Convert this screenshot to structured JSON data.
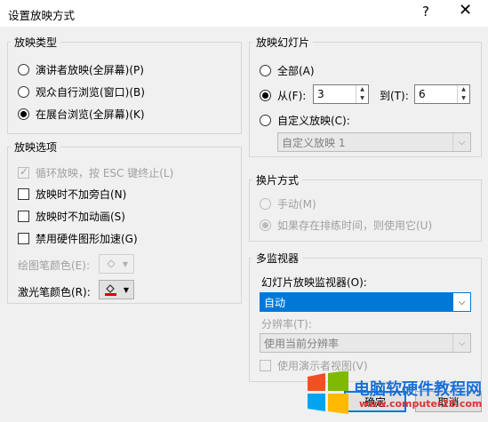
{
  "window": {
    "title": "设置放映方式",
    "help_symbol": "?",
    "close_symbol": "✕"
  },
  "show_type": {
    "legend": "放映类型",
    "options": [
      {
        "label": "演讲者放映(全屏幕)(P)",
        "selected": false
      },
      {
        "label": "观众自行浏览(窗口)(B)",
        "selected": false
      },
      {
        "label": "在展台浏览(全屏幕)(K)",
        "selected": true
      }
    ]
  },
  "show_options": {
    "legend": "放映选项",
    "checks": [
      {
        "label": "循环放映，按 ESC 键终止(L)",
        "checked": true,
        "disabled": true
      },
      {
        "label": "放映时不加旁白(N)",
        "checked": false,
        "disabled": false
      },
      {
        "label": "放映时不加动画(S)",
        "checked": false,
        "disabled": false
      },
      {
        "label": "禁用硬件图形加速(G)",
        "checked": false,
        "disabled": false
      }
    ],
    "pen_color_label": "绘图笔颜色(E):",
    "laser_color_label": "激光笔颜色(R):",
    "laser_color": "#e00000",
    "dropdown_arrow": "▼"
  },
  "slides": {
    "legend": "放映幻灯片",
    "all_label": "全部(A)",
    "from_label": "从(F):",
    "from_value": "3",
    "to_label": "到(T):",
    "to_value": "6",
    "custom_label": "自定义放映(C):",
    "custom_value": "自定义放映 1",
    "spin_up": "▲",
    "spin_down": "▼"
  },
  "advance": {
    "legend": "换片方式",
    "manual_label": "手动(M)",
    "timings_label": "如果存在排练时间，则使用它(U)"
  },
  "monitors": {
    "legend": "多监视器",
    "monitor_label": "幻灯片放映监视器(O):",
    "monitor_value": "自动",
    "resolution_label": "分辨率(T):",
    "resolution_value": "使用当前分辨率",
    "presenter_view_label": "使用演示者视图(V)"
  },
  "buttons": {
    "ok": "确定",
    "cancel": "取消"
  },
  "watermark": {
    "title": "电脑软硬件教程网",
    "url": "www.computer26.com"
  }
}
